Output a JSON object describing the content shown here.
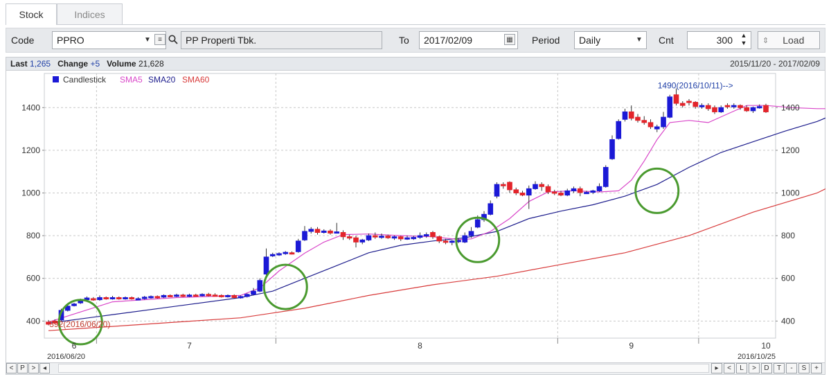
{
  "tabs": {
    "stock": "Stock",
    "indices": "Indices"
  },
  "toolbar": {
    "code_label": "Code",
    "code_value": "PPRO",
    "company_name": "PP Properti Tbk.",
    "to_label": "To",
    "to_value": "2017/02/09",
    "period_label": "Period",
    "period_value": "Daily",
    "cnt_label": "Cnt",
    "cnt_value": "300",
    "load_label": "Load"
  },
  "infobar": {
    "last_label": "Last",
    "last_value": "1,265",
    "change_label": "Change",
    "change_value": "+5",
    "volume_label": "Volume",
    "volume_value": "21,628",
    "date_range": "2015/11/20 - 2017/02/09"
  },
  "chart_data": {
    "type": "candlestick",
    "legend": [
      "Candlestick",
      "SMA5",
      "SMA20",
      "SMA60"
    ],
    "colors": {
      "up": "#1b19d6",
      "down": "#e3242b",
      "sma5": "#d946c9",
      "sma20": "#1c1c8c",
      "sma60": "#d83a3a",
      "circle": "#4a9a2f"
    },
    "ylim": [
      320,
      1560
    ],
    "y_ticks": [
      400,
      600,
      800,
      1000,
      1200,
      1400
    ],
    "month_labels": [
      "6",
      "7",
      "8",
      "9",
      "10"
    ],
    "start_date": "2016/06/20",
    "end_date": "2016/10/25",
    "annotation_low": "392(2016/06/20)",
    "annotation_high": "1490(2016/10/11)-->",
    "candles": [
      [
        395,
        385,
        405,
        380
      ],
      [
        400,
        390,
        408,
        385
      ],
      [
        405,
        450,
        458,
        400
      ],
      [
        450,
        470,
        475,
        445
      ],
      [
        472,
        480,
        485,
        468
      ],
      [
        485,
        500,
        505,
        480
      ],
      [
        500,
        508,
        515,
        495
      ],
      [
        505,
        500,
        512,
        495
      ],
      [
        500,
        510,
        520,
        495
      ],
      [
        510,
        505,
        515,
        500
      ],
      [
        505,
        510,
        518,
        500
      ],
      [
        510,
        505,
        515,
        500
      ],
      [
        505,
        510,
        515,
        500
      ],
      [
        510,
        505,
        515,
        500
      ],
      [
        505,
        505,
        512,
        498
      ],
      [
        505,
        512,
        518,
        500
      ],
      [
        512,
        515,
        520,
        505
      ],
      [
        515,
        512,
        520,
        505
      ],
      [
        512,
        520,
        525,
        508
      ],
      [
        520,
        518,
        525,
        512
      ],
      [
        518,
        522,
        528,
        512
      ],
      [
        522,
        518,
        528,
        512
      ],
      [
        518,
        522,
        528,
        512
      ],
      [
        522,
        520,
        528,
        515
      ],
      [
        520,
        525,
        530,
        515
      ],
      [
        525,
        522,
        532,
        515
      ],
      [
        522,
        520,
        530,
        515
      ],
      [
        520,
        518,
        525,
        510
      ],
      [
        518,
        520,
        525,
        510
      ],
      [
        520,
        510,
        525,
        505
      ],
      [
        510,
        515,
        520,
        505
      ],
      [
        515,
        525,
        530,
        510
      ],
      [
        525,
        540,
        555,
        520
      ],
      [
        540,
        590,
        600,
        535
      ],
      [
        620,
        700,
        740,
        615
      ],
      [
        705,
        712,
        720,
        700
      ],
      [
        712,
        716,
        722,
        705
      ],
      [
        716,
        722,
        728,
        710
      ],
      [
        720,
        718,
        726,
        712
      ],
      [
        725,
        775,
        785,
        720
      ],
      [
        780,
        820,
        845,
        775
      ],
      [
        820,
        830,
        840,
        810
      ],
      [
        830,
        815,
        840,
        805
      ],
      [
        815,
        822,
        830,
        810
      ],
      [
        822,
        812,
        830,
        805
      ],
      [
        815,
        818,
        860,
        810
      ],
      [
        815,
        795,
        825,
        780
      ],
      [
        795,
        790,
        805,
        780
      ],
      [
        790,
        770,
        800,
        745
      ],
      [
        770,
        780,
        785,
        760
      ],
      [
        780,
        800,
        810,
        775
      ],
      [
        800,
        795,
        815,
        785
      ],
      [
        795,
        798,
        810,
        785
      ],
      [
        798,
        790,
        805,
        785
      ],
      [
        790,
        795,
        800,
        780
      ],
      [
        795,
        785,
        800,
        775
      ],
      [
        785,
        790,
        800,
        780
      ],
      [
        790,
        792,
        800,
        780
      ],
      [
        792,
        800,
        815,
        785
      ],
      [
        800,
        805,
        815,
        790
      ],
      [
        815,
        795,
        822,
        785
      ],
      [
        795,
        775,
        800,
        765
      ],
      [
        775,
        770,
        785,
        760
      ],
      [
        770,
        775,
        780,
        755
      ],
      [
        772,
        778,
        790,
        765
      ],
      [
        770,
        800,
        815,
        765
      ],
      [
        800,
        820,
        840,
        790
      ],
      [
        840,
        875,
        895,
        835
      ],
      [
        875,
        900,
        915,
        865
      ],
      [
        900,
        950,
        965,
        895
      ],
      [
        985,
        1040,
        1050,
        975
      ],
      [
        1040,
        1035,
        1050,
        1020
      ],
      [
        1050,
        1015,
        1055,
        1000
      ],
      [
        1015,
        1000,
        1025,
        990
      ],
      [
        1000,
        990,
        1010,
        985
      ],
      [
        990,
        1020,
        1035,
        925
      ],
      [
        1020,
        1040,
        1055,
        1015
      ],
      [
        1040,
        1030,
        1050,
        1010
      ],
      [
        1030,
        1005,
        1040,
        995
      ],
      [
        1005,
        1000,
        1015,
        990
      ],
      [
        1000,
        990,
        1010,
        985
      ],
      [
        990,
        1010,
        1020,
        985
      ],
      [
        1010,
        1020,
        1030,
        1000
      ],
      [
        1020,
        1002,
        1030,
        985
      ],
      [
        1000,
        1003,
        1010,
        995
      ],
      [
        1003,
        1010,
        1015,
        995
      ],
      [
        1010,
        1030,
        1045,
        1005
      ],
      [
        1030,
        1120,
        1130,
        1025
      ],
      [
        1160,
        1250,
        1270,
        1155
      ],
      [
        1255,
        1335,
        1345,
        1250
      ],
      [
        1345,
        1380,
        1395,
        1335
      ],
      [
        1380,
        1350,
        1410,
        1340
      ],
      [
        1355,
        1340,
        1370,
        1330
      ],
      [
        1340,
        1330,
        1360,
        1320
      ],
      [
        1330,
        1310,
        1345,
        1300
      ],
      [
        1300,
        1310,
        1320,
        1285
      ],
      [
        1310,
        1355,
        1380,
        1300
      ],
      [
        1355,
        1450,
        1460,
        1350
      ],
      [
        1460,
        1420,
        1490,
        1410
      ],
      [
        1420,
        1410,
        1430,
        1400
      ],
      [
        1430,
        1425,
        1440,
        1410
      ],
      [
        1425,
        1405,
        1430,
        1395
      ],
      [
        1405,
        1410,
        1420,
        1395
      ],
      [
        1410,
        1395,
        1420,
        1385
      ],
      [
        1400,
        1380,
        1410,
        1370
      ],
      [
        1380,
        1400,
        1410,
        1375
      ],
      [
        1410,
        1405,
        1420,
        1395
      ],
      [
        1405,
        1410,
        1420,
        1395
      ],
      [
        1410,
        1400,
        1415,
        1390
      ],
      [
        1400,
        1385,
        1410,
        1380
      ],
      [
        1385,
        1400,
        1405,
        1375
      ],
      [
        1400,
        1405,
        1415,
        1395
      ],
      [
        1410,
        1380,
        1418,
        1375
      ]
    ],
    "sma5": [
      [
        0,
        395
      ],
      [
        10,
        490
      ],
      [
        20,
        510
      ],
      [
        30,
        520
      ],
      [
        33,
        555
      ],
      [
        36,
        635
      ],
      [
        40,
        718
      ],
      [
        43,
        770
      ],
      [
        46,
        805
      ],
      [
        50,
        808
      ],
      [
        55,
        800
      ],
      [
        60,
        795
      ],
      [
        64,
        782
      ],
      [
        66,
        785
      ],
      [
        69,
        820
      ],
      [
        72,
        880
      ],
      [
        75,
        960
      ],
      [
        78,
        1005
      ],
      [
        82,
        1010
      ],
      [
        86,
        1005
      ],
      [
        89,
        1010
      ],
      [
        91,
        1060
      ],
      [
        93,
        1150
      ],
      [
        95,
        1250
      ],
      [
        97,
        1330
      ],
      [
        100,
        1340
      ],
      [
        103,
        1330
      ],
      [
        106,
        1370
      ],
      [
        109,
        1410
      ],
      [
        112,
        1410
      ],
      [
        116,
        1400
      ],
      [
        120,
        1395
      ],
      [
        122,
        1395
      ]
    ],
    "sma20": [
      [
        0,
        390
      ],
      [
        10,
        430
      ],
      [
        20,
        470
      ],
      [
        30,
        510
      ],
      [
        35,
        540
      ],
      [
        40,
        600
      ],
      [
        45,
        660
      ],
      [
        50,
        720
      ],
      [
        55,
        755
      ],
      [
        60,
        775
      ],
      [
        65,
        790
      ],
      [
        70,
        820
      ],
      [
        75,
        880
      ],
      [
        80,
        915
      ],
      [
        85,
        945
      ],
      [
        90,
        985
      ],
      [
        95,
        1040
      ],
      [
        100,
        1120
      ],
      [
        105,
        1190
      ],
      [
        110,
        1240
      ],
      [
        115,
        1290
      ],
      [
        120,
        1335
      ],
      [
        122,
        1360
      ]
    ],
    "sma60": [
      [
        0,
        355
      ],
      [
        10,
        375
      ],
      [
        20,
        395
      ],
      [
        30,
        415
      ],
      [
        40,
        460
      ],
      [
        50,
        520
      ],
      [
        60,
        570
      ],
      [
        70,
        610
      ],
      [
        80,
        665
      ],
      [
        90,
        720
      ],
      [
        100,
        800
      ],
      [
        110,
        910
      ],
      [
        120,
        1000
      ],
      [
        122,
        1030
      ]
    ],
    "circles": [
      [
        5,
        395
      ],
      [
        37,
        560
      ],
      [
        67,
        780
      ],
      [
        95,
        1010
      ]
    ]
  },
  "bottom_nav": {
    "left": [
      "<",
      "P",
      ">",
      "◂"
    ],
    "right": [
      "▸",
      "<",
      "L",
      ">",
      "D",
      "T",
      "-",
      "S",
      "+"
    ]
  }
}
